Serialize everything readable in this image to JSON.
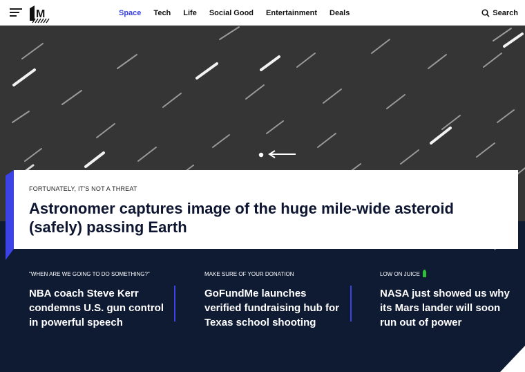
{
  "header": {
    "nav": [
      {
        "label": "Space",
        "active": true
      },
      {
        "label": "Tech",
        "active": false
      },
      {
        "label": "Life",
        "active": false
      },
      {
        "label": "Social Good",
        "active": false
      },
      {
        "label": "Entertainment",
        "active": false
      },
      {
        "label": "Deals",
        "active": false
      }
    ],
    "search_label": "Search",
    "logo_text": "M"
  },
  "colors": {
    "accent": "#3b42e6",
    "dark_navy": "#0f1a33",
    "battery_green": "#2fbf3a"
  },
  "hero": {
    "kicker": "FORTUNATELY, IT'S NOT A THREAT",
    "headline": "Astronomer captures image of the huge mile-wide asteroid (safely) passing Earth"
  },
  "stories": [
    {
      "kicker": "\"WHEN ARE WE GOING TO DO SOMETHING?\"",
      "title": "NBA coach Steve Kerr condemns U.S. gun control in powerful speech"
    },
    {
      "kicker": "MAKE SURE OF YOUR DONATION",
      "title": "GoFundMe launches verified fundraising hub for Texas school shooting"
    },
    {
      "kicker": "LOW ON JUICE",
      "title": "NASA just showed us why its Mars lander will soon run out of power",
      "icon": "battery-icon"
    }
  ]
}
